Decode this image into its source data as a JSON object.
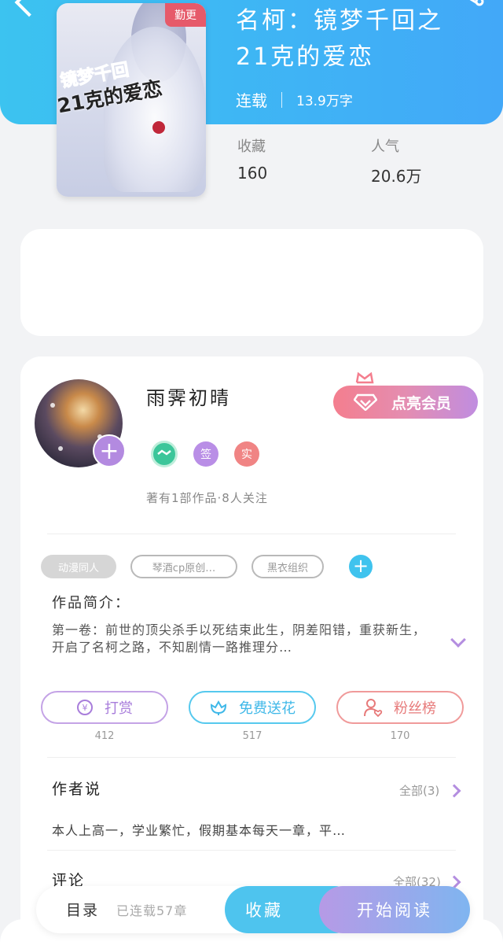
{
  "header": {
    "title": "名柯：镜梦千回之21克的爱恋",
    "status": "连载",
    "word_count": "13.9万字"
  },
  "cover": {
    "badge": "勤更",
    "title_line1": "镜梦千回",
    "title_line2": "21克的爱恋"
  },
  "stats": {
    "favorites_label": "收藏",
    "favorites_value": "160",
    "popularity_label": "人气",
    "popularity_value": "20.6万"
  },
  "author": {
    "name": "雨霁初晴",
    "vip_button": "点亮会员",
    "badge_sign": "签",
    "badge_real": "实",
    "summary": "著有1部作品·8人关注"
  },
  "tags": {
    "items": [
      "动漫同人",
      "琴酒cp原创…",
      "黑衣组织"
    ]
  },
  "intro": {
    "title": "作品简介：",
    "text": "第一卷：前世的顶尖杀手以死结束此生，阴差阳错，重获新生，开启了名柯之路，不知剧情一路推理分…"
  },
  "actions": {
    "reward_label": "打赏",
    "reward_count": "412",
    "flower_label": "免费送花",
    "flower_count": "517",
    "fans_label": "粉丝榜",
    "fans_count": "170"
  },
  "author_says": {
    "title": "作者说",
    "more": "全部(3)",
    "text": "本人上高一，学业繁忙，假期基本每天一章，平…"
  },
  "comments": {
    "title": "评论",
    "more": "全部(32)"
  },
  "bottom_bar": {
    "catalog": "目录",
    "progress": "已连载57章",
    "collect": "收藏",
    "read": "开始阅读"
  },
  "colors": {
    "header_blue": "#3fb3f5",
    "accent_purple": "#b48ee0",
    "vip_pink": "#f47e8e"
  },
  "icons": [
    "back-arrow-icon",
    "share-icon",
    "crown-icon",
    "diamond-icon",
    "plus-icon",
    "yen-icon",
    "flower-icon",
    "person-heart-icon",
    "chevron-down-icon",
    "chevron-right-icon"
  ]
}
